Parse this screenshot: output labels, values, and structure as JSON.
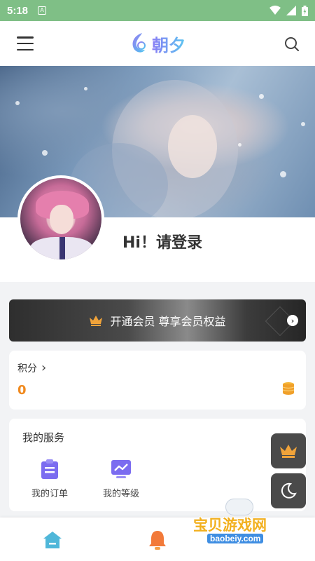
{
  "status_bar": {
    "time": "5:18",
    "notification_glyph": "A"
  },
  "header": {
    "logo_text": "朝夕",
    "menu_icon": "menu-icon",
    "search_icon": "search-icon"
  },
  "profile": {
    "greeting": "Hi！请登录"
  },
  "vip": {
    "label": "开通会员 尊享会员权益",
    "icon": "crown-icon"
  },
  "points": {
    "label": "积分",
    "value": "0",
    "chevron": "›"
  },
  "services": {
    "title": "我的服务",
    "items": [
      {
        "label": "我的订单",
        "icon": "order-icon"
      },
      {
        "label": "我的等级",
        "icon": "level-icon"
      }
    ]
  },
  "watermark": {
    "text": "宝贝游戏网",
    "url": "baobeiy.com"
  },
  "colors": {
    "status_bar": "#7fbf86",
    "accent_orange": "#f08a1f",
    "service_purple": "#7b6cf0",
    "home_tab": "#4fb7d9"
  }
}
